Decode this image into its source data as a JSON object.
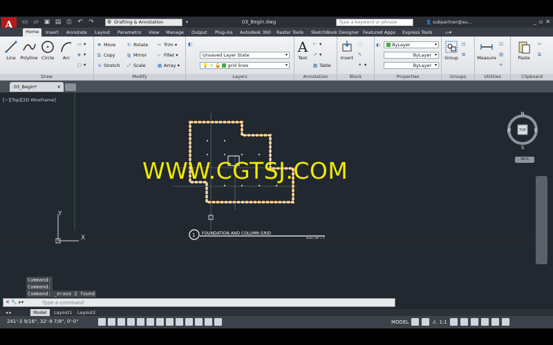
{
  "app": {
    "logo_letter": "A",
    "workspace": "Drafting & Annotation",
    "document_title": "03_Begin.dwg",
    "search_placeholder": "Type a keyword or phrase",
    "user": "subpartner@au..."
  },
  "ribbon_tabs": [
    "Home",
    "Insert",
    "Annotate",
    "Layout",
    "Parametric",
    "View",
    "Manage",
    "Output",
    "Plug-ins",
    "Autodesk 360",
    "Raster Tools",
    "SketchBook Designer",
    "Featured Apps",
    "Express Tools"
  ],
  "panels": {
    "draw": {
      "title": "Draw",
      "tools": [
        "Line",
        "Polyline",
        "Circle",
        "Arc"
      ]
    },
    "modify": {
      "title": "Modify",
      "tools": [
        "Move",
        "Rotate",
        "Trim",
        "Copy",
        "Mirror",
        "Fillet",
        "Stretch",
        "Scale",
        "Array"
      ]
    },
    "layers": {
      "title": "Layers",
      "layer_state": "Unsaved Layer State",
      "current_layer": "grid lines"
    },
    "annotation": {
      "title": "Annotation",
      "tools": [
        "Text",
        "Table"
      ]
    },
    "block": {
      "title": "Block",
      "tools": [
        "Insert"
      ]
    },
    "properties": {
      "title": "Properties",
      "color": "ByLayer",
      "linetype": "ByLayer",
      "lineweight": "ByLayer"
    },
    "groups": {
      "title": "Groups",
      "tools": [
        "Group"
      ]
    },
    "utilities": {
      "title": "Utilities",
      "tools": [
        "Measure"
      ]
    },
    "clipboard": {
      "title": "Clipboard",
      "tools": [
        "Paste"
      ]
    }
  },
  "document_tab": "03_Begin*",
  "viewport_label": "[−][Top][2D Wireframe]",
  "watermark": "WWW.CGTSJ.COM",
  "drawing": {
    "detail_number": "1",
    "detail_title": "FOUNDATION AND COLUMN GRID",
    "scale_text": "Scale: 1/8\" = 1'"
  },
  "viewcube": {
    "north": "N",
    "south": "S",
    "east": "E",
    "west": "W",
    "face": "TOP",
    "wcs": "WCS"
  },
  "command_history": [
    "Command:",
    "Command:",
    "Command:  _erase 2 found"
  ],
  "command_prompt": "Type a command",
  "layout_tabs": [
    "Model",
    "Layout1",
    "Layout2"
  ],
  "status": {
    "coordinates": "241'-3 9/16\", 32'-9 7/8\", 0'-0\"",
    "model": "MODEL",
    "scale": "1:1"
  },
  "colors": {
    "accent": "#b41b1b",
    "canvas": "#212830",
    "watermark": "#f2ea00",
    "building_outline": "#e8a23b"
  }
}
